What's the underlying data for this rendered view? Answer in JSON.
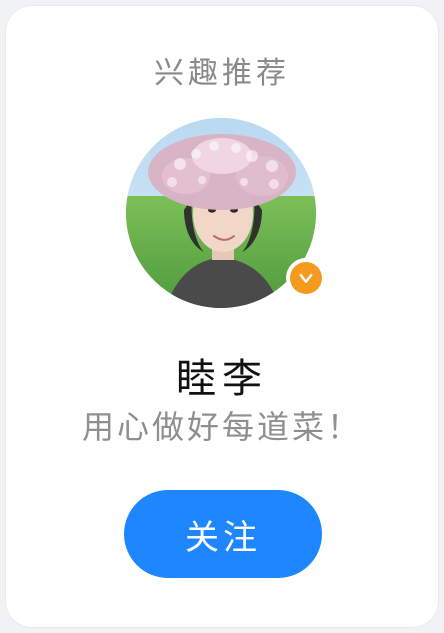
{
  "card": {
    "title": "兴趣推荐",
    "user": {
      "name": "睦李",
      "bio": "用心做好每道菜！",
      "verified_icon": "verified-check-icon"
    },
    "follow_label": "关注"
  },
  "colors": {
    "accent": "#1E86FF",
    "verified_badge": "#F39A1F",
    "title_text": "#8A8A8A",
    "name_text": "#111111",
    "bio_text": "#8F8F8F"
  }
}
